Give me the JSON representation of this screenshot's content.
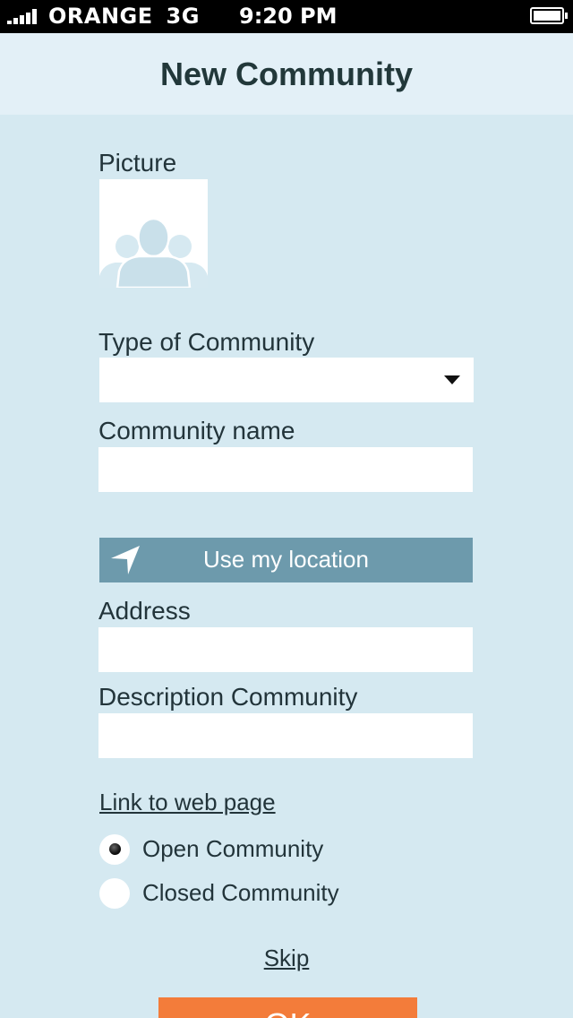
{
  "status_bar": {
    "carrier": "ORANGE",
    "network": "3G",
    "time": "9:20 PM"
  },
  "header": {
    "title": "New Community"
  },
  "form": {
    "picture_label": "Picture",
    "type_label": "Type of Community",
    "type_value": "",
    "name_label": "Community name",
    "name_value": "",
    "location_button": "Use my location",
    "address_label": "Address",
    "address_value": "",
    "description_label": "Description Community",
    "description_value": "",
    "link_label": "Link to web page",
    "radio_options": [
      {
        "label": "Open Community",
        "checked": true
      },
      {
        "label": "Closed Community",
        "checked": false
      }
    ]
  },
  "actions": {
    "skip_label": "Skip",
    "ok_label": "OK"
  },
  "colors": {
    "background": "#d5e9f1",
    "header": "#e3f0f7",
    "location_button": "#6d9aac",
    "ok_button": "#f37c3a",
    "text": "#22343a"
  }
}
